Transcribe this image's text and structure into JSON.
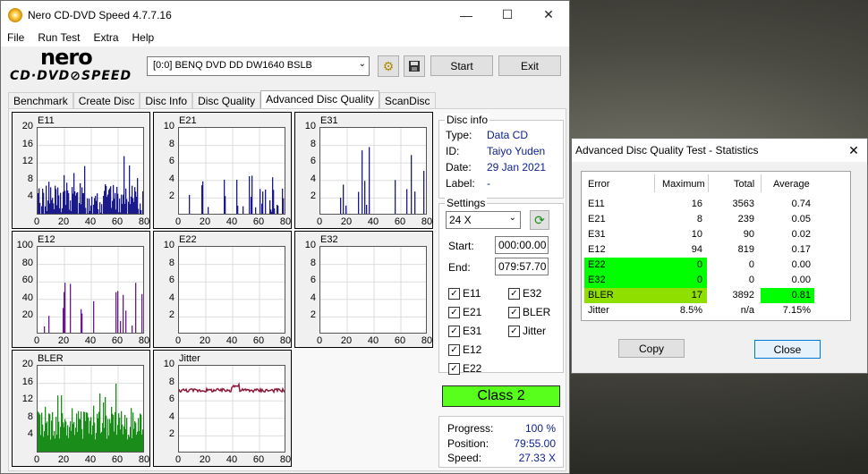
{
  "window": {
    "title": "Nero CD-DVD Speed 4.7.7.16",
    "controls": {
      "minimize": "—",
      "maximize": "☐",
      "close": "✕"
    }
  },
  "menu": [
    "File",
    "Run Test",
    "Extra",
    "Help"
  ],
  "logo": {
    "line1": "nero",
    "line2": "CD·DVD⊘SPEED"
  },
  "toolbar": {
    "drive": "[0:0]   BENQ DVD DD DW1640 BSLB",
    "start": "Start",
    "exit": "Exit",
    "icons": [
      "chip-icon",
      "save-icon"
    ]
  },
  "tabs": [
    "Benchmark",
    "Create Disc",
    "Disc Info",
    "Disc Quality",
    "Advanced Disc Quality",
    "ScanDisc"
  ],
  "active_tab": "Advanced Disc Quality",
  "disc_info": {
    "title": "Disc info",
    "type_label": "Type:",
    "type": "Data CD",
    "id_label": "ID:",
    "id": "Taiyo Yuden",
    "date_label": "Date:",
    "date": "29 Jan 2021",
    "label_label": "Label:",
    "label": "-"
  },
  "settings": {
    "title": "Settings",
    "speed": "24 X",
    "start_label": "Start:",
    "start": "000:00.00",
    "end_label": "End:",
    "end": "079:57.70",
    "checks": [
      {
        "label": "E11",
        "checked": true
      },
      {
        "label": "E32",
        "checked": true
      },
      {
        "label": "E21",
        "checked": true
      },
      {
        "label": "BLER",
        "checked": true
      },
      {
        "label": "E31",
        "checked": true
      },
      {
        "label": "Jitter",
        "checked": true
      },
      {
        "label": "E12",
        "checked": true
      },
      {
        "label": "E22",
        "checked": true
      }
    ]
  },
  "class_label": "Class 2",
  "progress": {
    "progress_label": "Progress:",
    "progress": "100 %",
    "position_label": "Position:",
    "position": "79:55.00",
    "speed_label": "Speed:",
    "speed": "27.33 X"
  },
  "stats": {
    "title": "Advanced Disc Quality Test - Statistics",
    "headers": [
      "Error",
      "Maximum",
      "Total",
      "Average"
    ],
    "rows": [
      {
        "error": "E11",
        "max": "16",
        "total": "3563",
        "avg": "0.74"
      },
      {
        "error": "E21",
        "max": "8",
        "total": "239",
        "avg": "0.05"
      },
      {
        "error": "E31",
        "max": "10",
        "total": "90",
        "avg": "0.02"
      },
      {
        "error": "E12",
        "max": "94",
        "total": "819",
        "avg": "0.17"
      },
      {
        "error": "E22",
        "max": "0",
        "total": "0",
        "avg": "0.00"
      },
      {
        "error": "E32",
        "max": "0",
        "total": "0",
        "avg": "0.00"
      },
      {
        "error": "BLER",
        "max": "17",
        "total": "3892",
        "avg": "0.81"
      },
      {
        "error": "Jitter",
        "max": "8.5%",
        "total": "n/a",
        "avg": "7.15%"
      }
    ],
    "copy": "Copy",
    "close": "Close",
    "highlight_colors": {
      "green": "#00ff00",
      "lime": "#8fe000"
    }
  },
  "chart_data": [
    {
      "type": "bar",
      "title": "E11",
      "color": "#1a1a8c",
      "ylim": [
        0,
        20
      ],
      "yticks": [
        4,
        8,
        12,
        16,
        20
      ],
      "xlim": [
        0,
        80
      ],
      "xticks": [
        0,
        20,
        40,
        60,
        80
      ]
    },
    {
      "type": "bar",
      "title": "E21",
      "color": "#1a1a8c",
      "ylim": [
        0,
        10
      ],
      "yticks": [
        2,
        4,
        6,
        8,
        10
      ],
      "xlim": [
        0,
        80
      ],
      "xticks": [
        0,
        20,
        40,
        60,
        80
      ]
    },
    {
      "type": "bar",
      "title": "E31",
      "color": "#1a1a8c",
      "ylim": [
        0,
        10
      ],
      "yticks": [
        2,
        4,
        6,
        8,
        10
      ],
      "xlim": [
        0,
        80
      ],
      "xticks": [
        0,
        20,
        40,
        60,
        80
      ]
    },
    {
      "type": "bar",
      "title": "E12",
      "color": "#6a1a8c",
      "ylim": [
        0,
        100
      ],
      "yticks": [
        20,
        40,
        60,
        80,
        100
      ],
      "xlim": [
        0,
        80
      ],
      "xticks": [
        0,
        20,
        40,
        60,
        80
      ]
    },
    {
      "type": "bar",
      "title": "E22",
      "color": "#6a1a8c",
      "ylim": [
        0,
        10
      ],
      "yticks": [
        2,
        4,
        6,
        8,
        10
      ],
      "xlim": [
        0,
        80
      ],
      "xticks": [
        0,
        20,
        40,
        60,
        80
      ]
    },
    {
      "type": "bar",
      "title": "E32",
      "color": "#6a1a8c",
      "ylim": [
        0,
        10
      ],
      "yticks": [
        2,
        4,
        6,
        8,
        10
      ],
      "xlim": [
        0,
        80
      ],
      "xticks": [
        0,
        20,
        40,
        60,
        80
      ]
    },
    {
      "type": "bar",
      "title": "BLER",
      "color": "#1a8c1a",
      "ylim": [
        0,
        20
      ],
      "yticks": [
        4,
        8,
        12,
        16,
        20
      ],
      "xlim": [
        0,
        80
      ],
      "xticks": [
        0,
        20,
        40,
        60,
        80
      ]
    },
    {
      "type": "line",
      "title": "Jitter",
      "color": "#8c1a3a",
      "ylim": [
        0,
        10
      ],
      "yticks": [
        2,
        4,
        6,
        8,
        10
      ],
      "xlim": [
        0,
        80
      ],
      "xticks": [
        0,
        20,
        40,
        60,
        80
      ]
    }
  ]
}
